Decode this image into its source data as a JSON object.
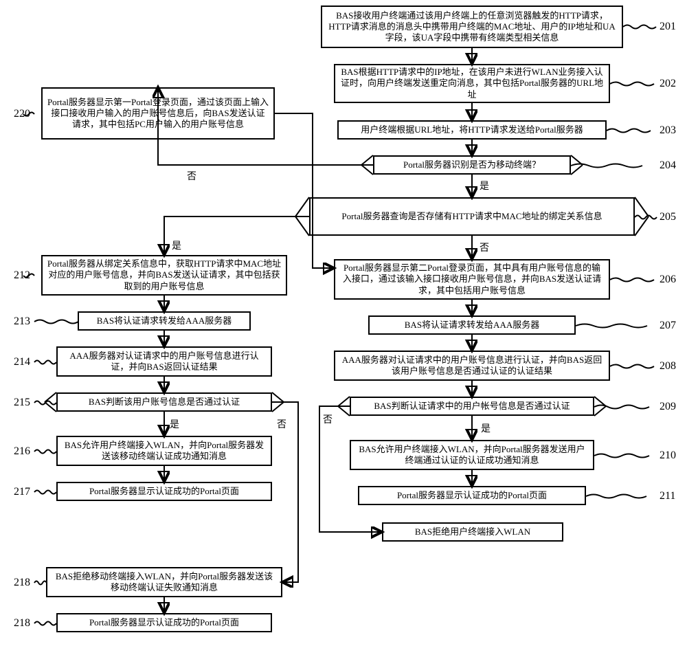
{
  "steps": {
    "s201": {
      "num": "201",
      "text": "BAS接收用户终端通过该用户终端上的任意浏览器触发的HTTP请求，HTTP请求消息的消息头中携带用户终端的MAC地址、用户的IP地址和UA字段，该UA字段中携带有终端类型相关信息"
    },
    "s202": {
      "num": "202",
      "text": "BAS根据HTTP请求中的IP地址，在该用户未进行WLAN业务接入认证时，向用户终端发送重定向消息，其中包括Portal服务器的URL地址"
    },
    "s203": {
      "num": "203",
      "text": "用户终端根据URL地址，将HTTP请求发送给Portal服务器"
    },
    "s204": {
      "num": "204",
      "text": "Portal服务器识别是否为移动终端？"
    },
    "s205": {
      "num": "205",
      "text": "Portal服务器查询是否存储有HTTP请求中MAC地址的绑定关系信息"
    },
    "s206": {
      "num": "206",
      "text": "Portal服务器显示第二Portal登录页面，其中具有用户账号信息的输入接口，通过该输入接口接收用户账号信息，并向BAS发送认证请求，其中包括用户账号信息"
    },
    "s207": {
      "num": "207",
      "text": "BAS将认证请求转发给AAA服务器"
    },
    "s208": {
      "num": "208",
      "text": "AAA服务器对认证请求中的用户账号信息进行认证，并向BAS返回该用户账号信息是否通过认证的认证结果"
    },
    "s209": {
      "num": "209",
      "text": "BAS判断认证请求中的用户帐号信息是否通过认证"
    },
    "s210": {
      "num": "210",
      "text": "BAS允许用户终端接入WLAN，并向Portal服务器发送用户终端通过认证的认证成功通知消息"
    },
    "s211": {
      "num": "211",
      "text": "Portal服务器显示认证成功的Portal页面"
    },
    "s212": {
      "num": "212",
      "text": "Portal服务器从绑定关系信息中，获取HTTP请求中MAC地址对应的用户账号信息，并向BAS发送认证请求，其中包括获取到的用户账号信息"
    },
    "s213": {
      "num": "213",
      "text": "BAS将认证请求转发给AAA服务器"
    },
    "s214": {
      "num": "214",
      "text": "AAA服务器对认证请求中的用户账号信息进行认证，并向BAS返回认证结果"
    },
    "s215": {
      "num": "215",
      "text": "BAS判断该用户账号信息是否通过认证"
    },
    "s216": {
      "num": "216",
      "text": "BAS允许用户终端接入WLAN，并向Portal服务器发送该移动终端认证成功通知消息"
    },
    "s217": {
      "num": "217",
      "text": "Portal服务器显示认证成功的Portal页面"
    },
    "s218": {
      "num": "218",
      "text": "BAS拒绝移动终端接入WLAN，并向Portal服务器发送该移动终端认证失败通知消息"
    },
    "s218b": {
      "num": "218",
      "text": "Portal服务器显示认证成功的Portal页面"
    },
    "s220": {
      "num": "220",
      "text": "Portal服务器显示第一Portal登录页面，通过该页面上输入接口接收用户输入的用户账号信息后，向BAS发送认证请求，其中包括PC用户输入的用户账号信息"
    },
    "rlast": {
      "text": "BAS拒绝用户终端接入WLAN"
    }
  },
  "labels": {
    "yes": "是",
    "no": "否"
  }
}
